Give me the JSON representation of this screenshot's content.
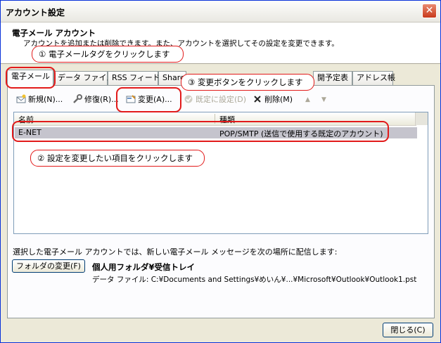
{
  "window": {
    "title": "アカウント設定",
    "close_glyph": "✕"
  },
  "header": {
    "title": "電子メール アカウント",
    "description": "アカウントを追加または削除できます。また、アカウントを選択してその設定を変更できます。"
  },
  "annotations": {
    "step1": "① 電子メールタグをクリックします",
    "step2": "② 設定を変更したい項目をクリックします",
    "step3": "③ 変更ボタンをクリックします"
  },
  "tabs": [
    "電子メール",
    "データ ファイル",
    "RSS フィード",
    "Share",
    "開予定表",
    "アドレス帳"
  ],
  "toolbar": {
    "new": "新規(N)...",
    "repair": "修復(R)...",
    "change": "変更(A)...",
    "set_default": "既定に設定(D)",
    "delete": "削除(M)",
    "up": "▲",
    "down": "▼"
  },
  "list": {
    "columns": {
      "name": "名前",
      "type": "種類"
    },
    "rows": [
      {
        "name": "E-NET",
        "type": "POP/SMTP (送信で使用する既定のアカウント)"
      }
    ]
  },
  "delivery": {
    "text": "選択した電子メール アカウントでは、新しい電子メール メッセージを次の場所に配信します:",
    "change_folder": "フォルダの変更(F)",
    "folder": "個人用フォルダ¥受信トレイ",
    "data_file": "データ ファイル: C:¥Documents and Settings¥めいん¥...¥Microsoft¥Outlook¥Outlook1.pst"
  },
  "close_button": "閉じる(C)",
  "colors": {
    "annotation": "#e21a1a",
    "selected_row": "#c5c4cd",
    "title_close": "#c8391c"
  }
}
